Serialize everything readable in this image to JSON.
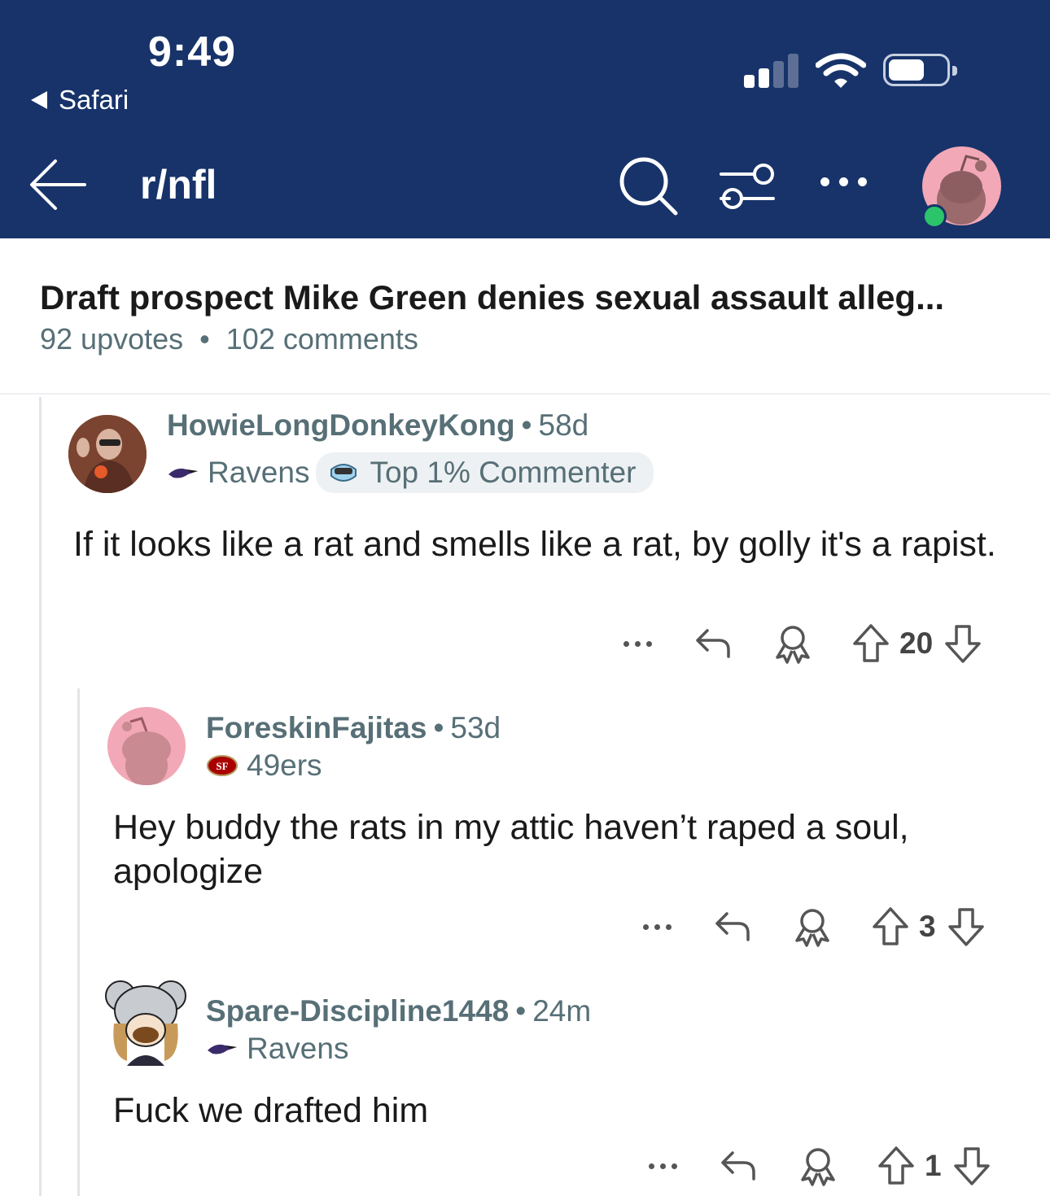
{
  "status_bar": {
    "time": "9:49",
    "back_app": "Safari"
  },
  "nav": {
    "subreddit": "r/nfl",
    "icons": [
      "back-arrow-icon",
      "search-icon",
      "filter-icon",
      "more-icon",
      "avatar"
    ]
  },
  "post": {
    "title": "Draft prospect Mike Green denies sexual assault alleg...",
    "upvotes": "92 upvotes",
    "dot": "•",
    "comments": "102 comments"
  },
  "comments": [
    {
      "username": "HowieLongDonkeyKong",
      "age": "58d",
      "flair": "Ravens",
      "badge": "Top 1% Commenter",
      "body": "If it looks like a rat and smells like a rat, by golly it's a rapist.",
      "votes": "20"
    },
    {
      "username": "ForeskinFajitas",
      "age": "53d",
      "flair": "49ers",
      "body": "Hey buddy the rats in my attic haven’t raped a soul, apologize",
      "votes": "3"
    },
    {
      "username": "Spare-Discipline1448",
      "age": "24m",
      "flair": "Ravens",
      "body": "Fuck we drafted him",
      "votes": "1"
    }
  ],
  "colors": {
    "header_bg": "#17336a",
    "meta_text": "#576f76",
    "online": "#2bc46b",
    "avatar_pink": "#f2a8b6"
  }
}
